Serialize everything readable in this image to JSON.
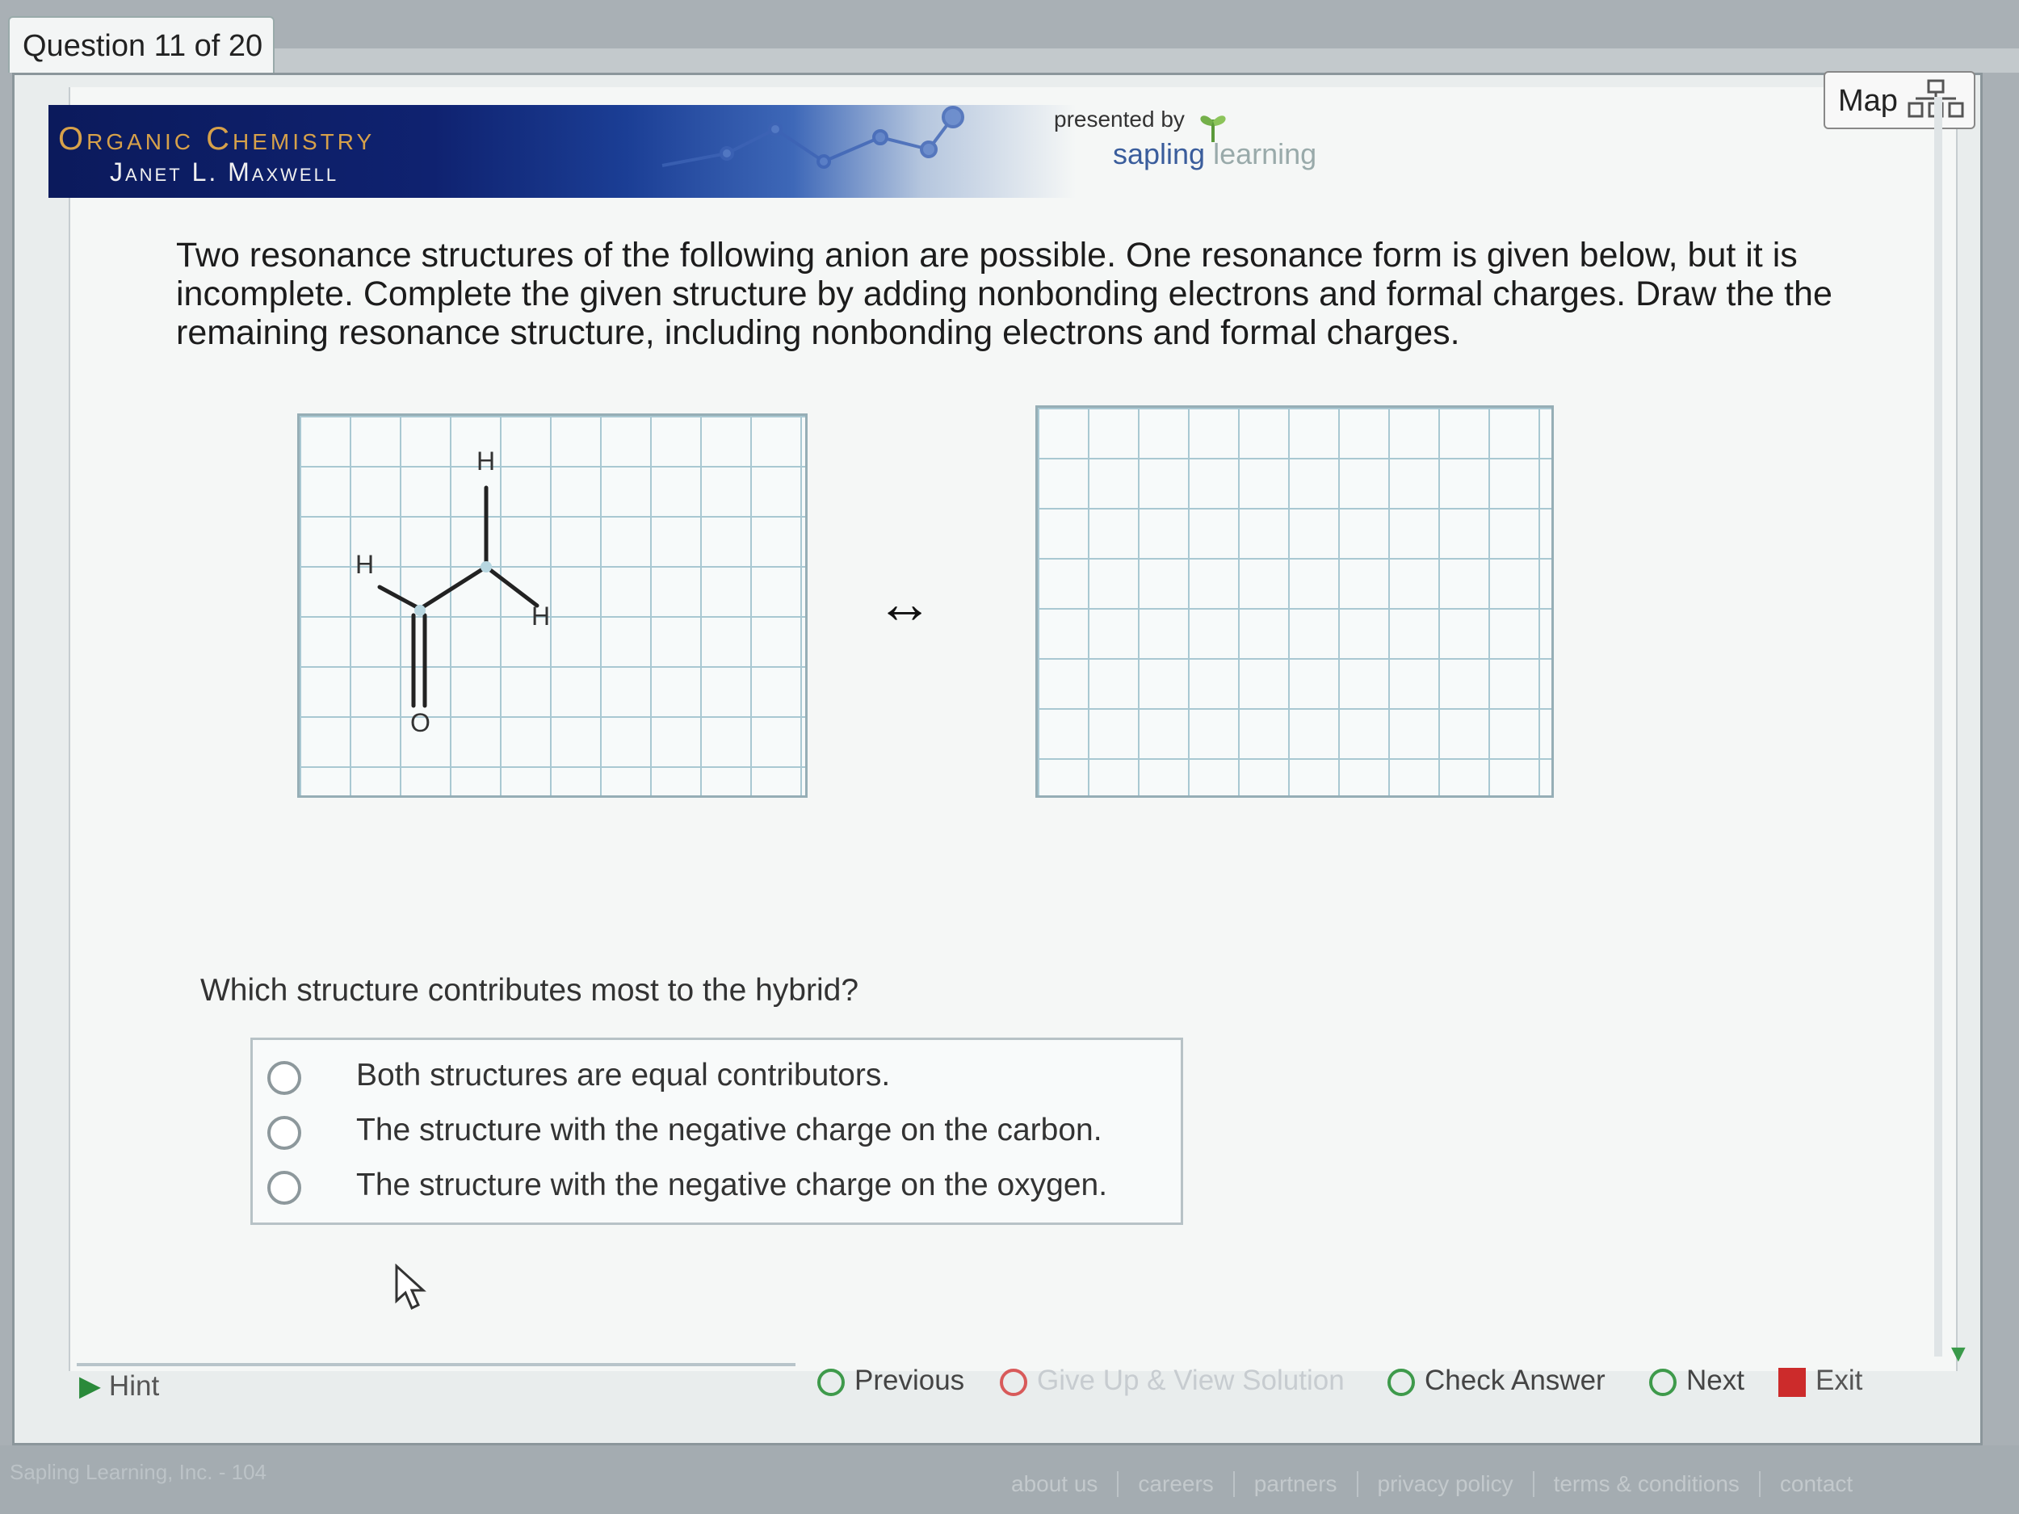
{
  "tab": {
    "label": "Question 11 of 20"
  },
  "banner": {
    "title": "Organic Chemistry",
    "author": "Janet L. Maxwell",
    "presented_by": "presented by",
    "brand_a": "sapling",
    "brand_b": "learning"
  },
  "map_button": {
    "label": "Map"
  },
  "question": {
    "text": "Two resonance structures of the following anion are possible. One resonance form is given below, but it is incomplete. Complete the given structure by adding nonbonding electrons and formal charges. Draw the the remaining resonance structure, including nonbonding electrons and formal charges."
  },
  "molecule": {
    "atoms": {
      "h_top": "H",
      "h_left": "H",
      "h_right": "H",
      "o": "O"
    }
  },
  "resonance_arrow": "↔",
  "hybrid": {
    "question": "Which structure contributes most to the hybrid?",
    "options": [
      "Both structures are equal contributors.",
      "The structure with the negative charge on the carbon.",
      "The structure with the negative charge on the oxygen."
    ]
  },
  "toolbar": {
    "hint": "Hint",
    "previous": "Previous",
    "give_up": "Give Up & View Solution",
    "check": "Check Answer",
    "next": "Next",
    "exit": "Exit"
  },
  "footer": {
    "copyright": "Sapling Learning, Inc. - 104",
    "links": [
      "about us",
      "careers",
      "partners",
      "privacy policy",
      "terms & conditions",
      "contact"
    ]
  },
  "colors": {
    "banner_title": "#d7a14a",
    "accent_green": "#3e9a4b",
    "exit_red": "#cc2b2b"
  }
}
